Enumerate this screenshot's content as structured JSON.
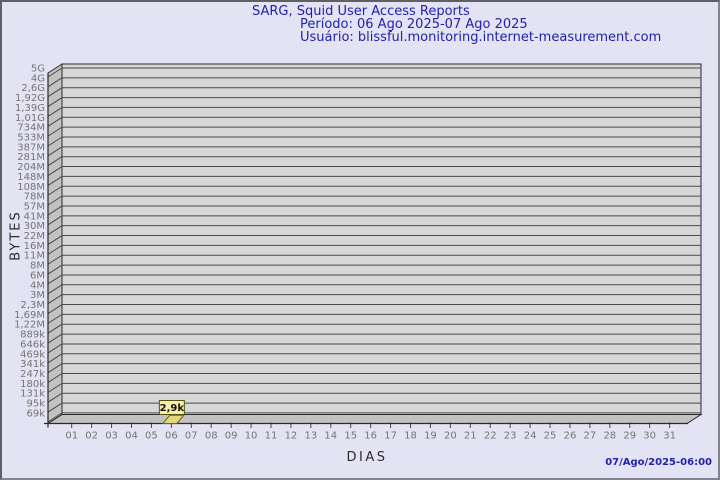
{
  "header": {
    "title": "SARG, Squid User Access Reports",
    "period": "Período: 06 Ago 2025-07 Ago 2025",
    "user": "Usuário: blissful.monitoring.internet-measurement.com"
  },
  "footer": {
    "timestamp": "07/Ago/2025-06:00"
  },
  "chart_data": {
    "type": "bar",
    "title": "SARG, Squid User Access Reports",
    "xlabel": "DIAS",
    "ylabel": "BYTES",
    "x_categories": [
      "01",
      "02",
      "03",
      "04",
      "05",
      "06",
      "07",
      "08",
      "09",
      "10",
      "11",
      "12",
      "13",
      "14",
      "15",
      "16",
      "17",
      "18",
      "19",
      "20",
      "21",
      "22",
      "23",
      "24",
      "25",
      "26",
      "27",
      "28",
      "29",
      "30",
      "31"
    ],
    "y_tick_labels": [
      "5G",
      "4G",
      "2,6G",
      "1,92G",
      "1,39G",
      "1,01G",
      "734M",
      "533M",
      "387M",
      "281M",
      "204M",
      "148M",
      "108M",
      "78M",
      "57M",
      "41M",
      "30M",
      "22M",
      "16M",
      "11M",
      "8M",
      "6M",
      "4M",
      "3M",
      "2,3M",
      "1,69M",
      "1,22M",
      "889k",
      "646k",
      "469k",
      "341k",
      "247k",
      "180k",
      "131k",
      "95k",
      "69k"
    ],
    "y_axis_range": [
      "69k",
      "5G"
    ],
    "bars": [
      {
        "x": "06",
        "label": "2,9k",
        "value_bytes": 2900
      }
    ],
    "grid": "horizontal",
    "legend": false
  },
  "colors": {
    "title_text": "#2222ac",
    "page_bg": "#e3e3f3",
    "plot_bg": "#d7d7d7",
    "wall_bg": "#c2c2c2",
    "grid_line": "#4a4a4a",
    "axis_line": "#2a2a2a",
    "tick_text": "#757575",
    "bar_fill": "#e8d67a",
    "bar_border": "#6d6414",
    "annotation_bg": "#f6efa7",
    "annotation_border": "#55500f",
    "annotation_text": "#141414"
  }
}
